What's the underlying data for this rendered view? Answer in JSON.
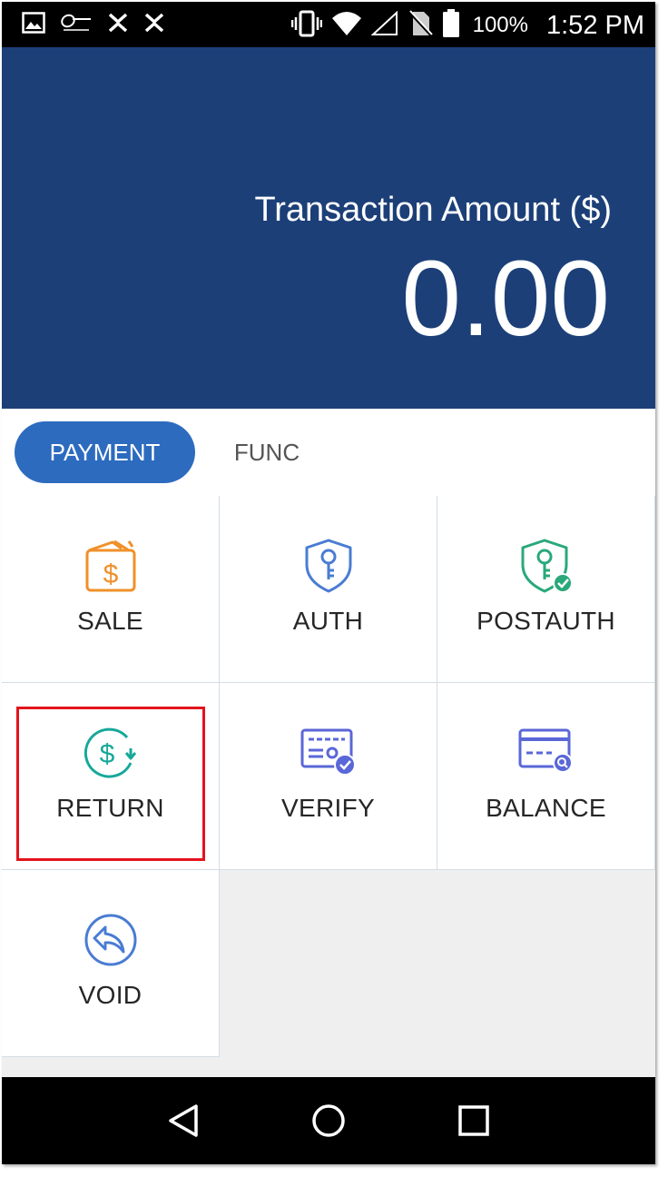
{
  "status_bar": {
    "left_icons": [
      "gallery-icon",
      "pax-logo-icon",
      "app-x-icon",
      "app-x-icon"
    ],
    "right_icons": [
      "vibrate-icon",
      "wifi-icon",
      "signal-icon",
      "no-sim-icon",
      "battery-icon"
    ],
    "battery_percent": "100%",
    "time": "1:52 PM"
  },
  "header": {
    "amount_label": "Transaction Amount ($)",
    "amount_value": "0.00",
    "background": "#1c3f78"
  },
  "tabs": [
    {
      "label": "PAYMENT",
      "active": true
    },
    {
      "label": "FUNC",
      "active": false
    }
  ],
  "tiles": [
    {
      "label": "SALE",
      "icon": "wallet-dollar-icon",
      "color": "#f0902a"
    },
    {
      "label": "AUTH",
      "icon": "shield-key-icon",
      "color": "#4a7cd3"
    },
    {
      "label": "POSTAUTH",
      "icon": "shield-key-check-icon",
      "color": "#2aa87a"
    },
    {
      "label": "RETURN",
      "icon": "dollar-return-icon",
      "color": "#16a89a",
      "highlighted": true
    },
    {
      "label": "VERIFY",
      "icon": "card-check-icon",
      "color": "#5a67d8"
    },
    {
      "label": "BALANCE",
      "icon": "card-search-icon",
      "color": "#5a67d8"
    },
    {
      "label": "VOID",
      "icon": "void-arrow-icon",
      "color": "#4a7cd3"
    }
  ],
  "nav_bar": {
    "buttons": [
      "back-icon",
      "home-icon",
      "recents-icon"
    ]
  },
  "colors": {
    "accent": "#2d6bbf",
    "highlight_border": "#e3141c"
  }
}
